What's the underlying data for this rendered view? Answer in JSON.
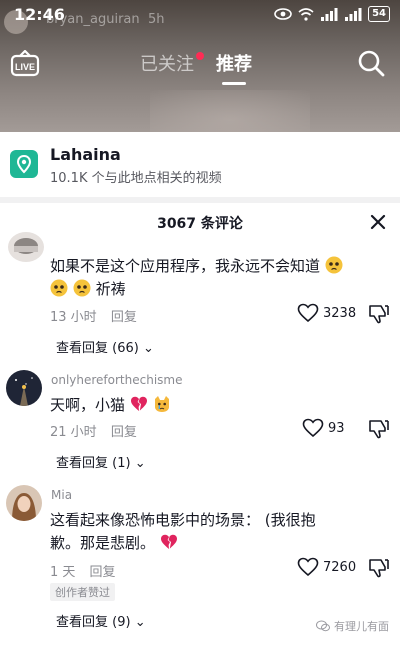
{
  "status_bar": {
    "time": "12:46",
    "battery": "54",
    "ghost_username": "bryan_aguiran",
    "ghost_time": "5h"
  },
  "nav": {
    "tab_following": "已关注",
    "tab_foryou": "推荐",
    "live_label": "LIVE"
  },
  "location": {
    "name": "Lahaina",
    "subtitle": "10.1K 个与此地点相关的视频"
  },
  "comments_panel": {
    "count_label": "3067 条评论",
    "comments": [
      {
        "username": "",
        "text_line1": "如果不是这个应用程序，我永远不会知道",
        "text_line2_suffix": "祈祷",
        "time": "13 小时",
        "reply_label": "回复",
        "likes": "3238",
        "view_replies": "查看回复 (66)"
      },
      {
        "username": "onlyhereforthechisme",
        "text": "天啊，小猫",
        "time": "21 小时",
        "reply_label": "回复",
        "likes": "93",
        "view_replies": "查看回复 (1)"
      },
      {
        "username": "Mia",
        "text_line1": "这看起来像恐怖电影中的场景： (我很抱",
        "text_line2": "歉。那是悲剧。",
        "time": "1 天",
        "reply_label": "回复",
        "likes": "7260",
        "creator_badge": "创作者赞过",
        "view_replies": "查看回复 (9)"
      }
    ]
  },
  "watermark": "有理儿有面"
}
